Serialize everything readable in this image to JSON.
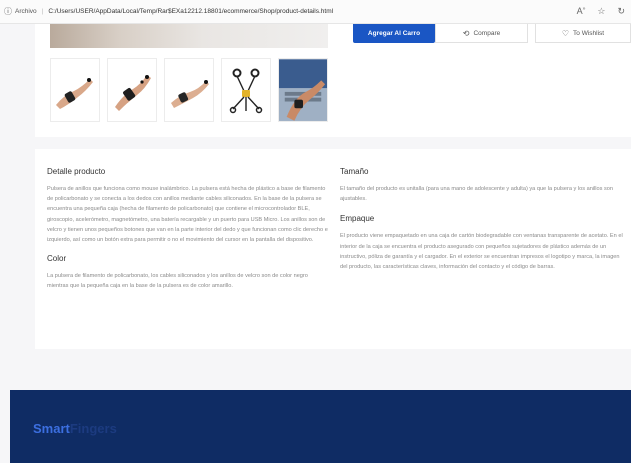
{
  "browser": {
    "info_label": "Archivo",
    "url": "C:/Users/USER/AppData/Local/Temp/Rar$EXa12212.18801/ecommerce/Shop/product-details.html",
    "icons": [
      "read-aloud-icon",
      "favorite-star-icon",
      "refresh-icon"
    ]
  },
  "actions": {
    "add_to_cart": "Agregar Al Carro",
    "compare": "Compare",
    "wishlist": "To Wishlist"
  },
  "gallery": {
    "thumbnails": [
      "thumbnail-1",
      "thumbnail-2",
      "thumbnail-3",
      "thumbnail-4",
      "thumbnail-5"
    ]
  },
  "details": {
    "product_heading": "Detalle producto",
    "product_text": "Pulsera de anillos que funciona como mouse inalámbrico. La pulsera está hecha de plástico a base de filamento de policarbonato y se conecta a los dedos con anillos mediante cables siliconados. En la base de la pulsera se encuentra una pequeña caja (hecha de filamento de policarbonato) que contiene el microcontrolador BLE, giroscopio, acelerómetro, magnetómetro, una batería recargable y un puerto para USB Micro. Los anillos son de velcro y tienen unos pequeños botones que van en la parte interior del dedo y que funcionan como clic derecho e izquierdo, así como un botón extra para permitir o no el movimiento del cursor en la pantalla del dispositivo.",
    "color_heading": "Color",
    "color_text": "La pulsera de filamento de policarbonato, los cables siliconados y los anillos de velcro son de color negro mientras que la pequeña caja en la base de la pulsera es de color amarillo.",
    "size_heading": "Tamaño",
    "size_text": "El tamaño del producto es unitalla (para una mano de adolescente y adulta) ya que la pulsera y los anillos son ajustables.",
    "packaging_heading": "Empaque",
    "packaging_text": "El producto viene empaquetado en una caja de cartón biodegradable con ventanas transparente de acetato. En el interior de la caja se encuentra el producto asegurado con pequeños sujetadores de plástico además de un instructivo, póliza de garantía y el cargador. En el exterior se encuentran impresos el logotipo y marca, la imagen del producto, las características claves, información del contacto y el código de barras."
  },
  "footer": {
    "logo_part1": "Smart",
    "logo_part2": "Fingers"
  }
}
